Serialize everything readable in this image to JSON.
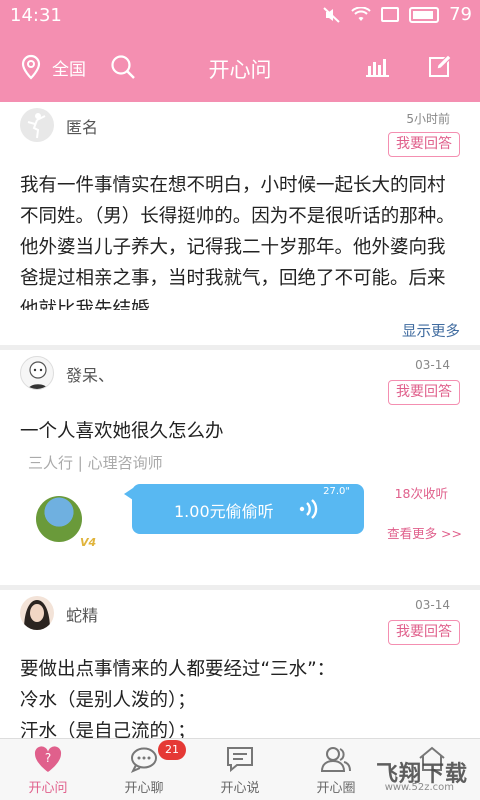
{
  "status_bar": {
    "time": "14:31",
    "battery": "79"
  },
  "header": {
    "location": "全国",
    "title": "开心问"
  },
  "feed": [
    {
      "user": "匿名",
      "time": "5小时前",
      "answer_button": "我要回答",
      "question": "我有一件事情实在想不明白，小时候一起长大的同村不同姓。（男）长得挺帅的。因为不是很听话的那种。他外婆当儿子养大，记得我二十岁那年。他外婆向我爸提过相亲之事，当时我就气，回绝了不可能。后来他就比我先结婚",
      "show_more": "显示更多"
    },
    {
      "user": "發呆、",
      "time": "03-14",
      "answer_button": "我要回答",
      "question": "一个人喜欢她很久怎么办",
      "answerer": "三人行 | 心理咨询师",
      "listen_price": "1.00元偷偷听",
      "listen_duration": "27.0\"",
      "collect_count": "18次收听",
      "view_more": "查看更多 >>",
      "level_badge": "V4"
    },
    {
      "user": "蛇精",
      "time": "03-14",
      "answer_button": "我要回答",
      "question_lines": [
        "要做出点事情来的人都要经过“三水”：",
        " 冷水（是别人泼的）；",
        " 汗水（是自己流的）；"
      ]
    }
  ],
  "tabs": [
    {
      "label": "开心问",
      "icon": "heart-question-icon",
      "active": true
    },
    {
      "label": "开心聊",
      "icon": "chat-bubble-icon",
      "active": false
    },
    {
      "label": "开心说",
      "icon": "message-square-icon",
      "active": false
    },
    {
      "label": "开心圈",
      "icon": "people-icon",
      "active": false
    },
    {
      "label": "",
      "icon": "home-icon",
      "active": false
    }
  ],
  "chat_badge": "21",
  "watermark": {
    "text": "飞翔下载",
    "url": "www.52z.com"
  },
  "colors": {
    "brand": "#f48fb1",
    "accent": "#e0608c",
    "link": "#3f6b9f",
    "listen": "#58b8f2"
  }
}
